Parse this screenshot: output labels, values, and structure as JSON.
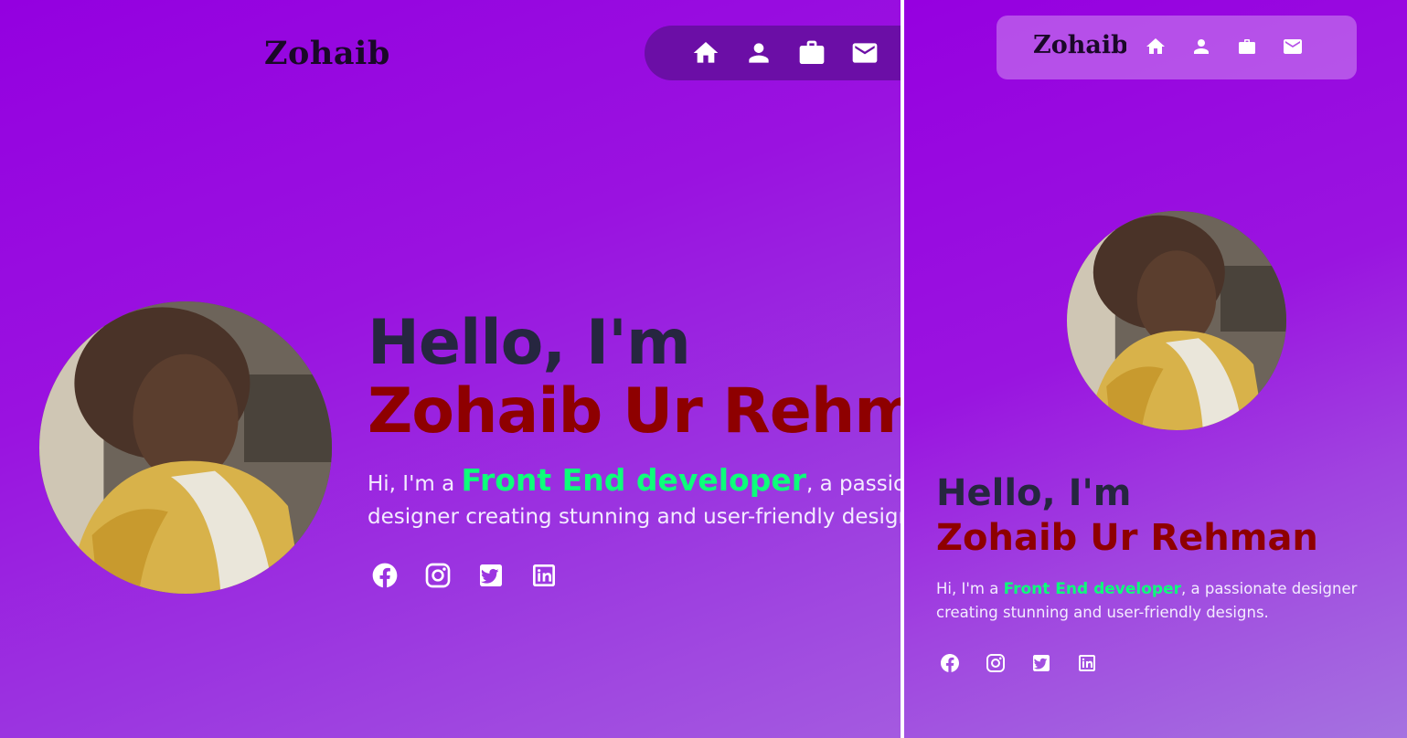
{
  "brand": {
    "logo_text": "Zohaib"
  },
  "nav": {
    "items": [
      {
        "icon": "home-icon",
        "label": "Home"
      },
      {
        "icon": "user-icon",
        "label": "About"
      },
      {
        "icon": "briefcase-icon",
        "label": "Portfolio"
      },
      {
        "icon": "mail-icon",
        "label": "Contact"
      }
    ]
  },
  "hero": {
    "greeting": "Hello, I'm",
    "name": "Zohaib Ur Rehman",
    "intro_prefix": "Hi, I'm a ",
    "role": "Front End developer",
    "intro_suffix": ", a passionate designer creating stunning and user-friendly designs."
  },
  "avatar": {
    "description": "profile-photo"
  },
  "socials": [
    {
      "icon": "facebook-icon",
      "network": "Facebook"
    },
    {
      "icon": "instagram-icon",
      "network": "Instagram"
    },
    {
      "icon": "twitter-icon",
      "network": "Twitter"
    },
    {
      "icon": "linkedin-icon",
      "network": "LinkedIn"
    }
  ],
  "colors": {
    "background_purple": "#9a10e0",
    "greeting_color": "#262640",
    "name_color": "#8e0000",
    "role_color": "#0dff7a",
    "nav_pill_desktop": "#6b0ea6"
  }
}
